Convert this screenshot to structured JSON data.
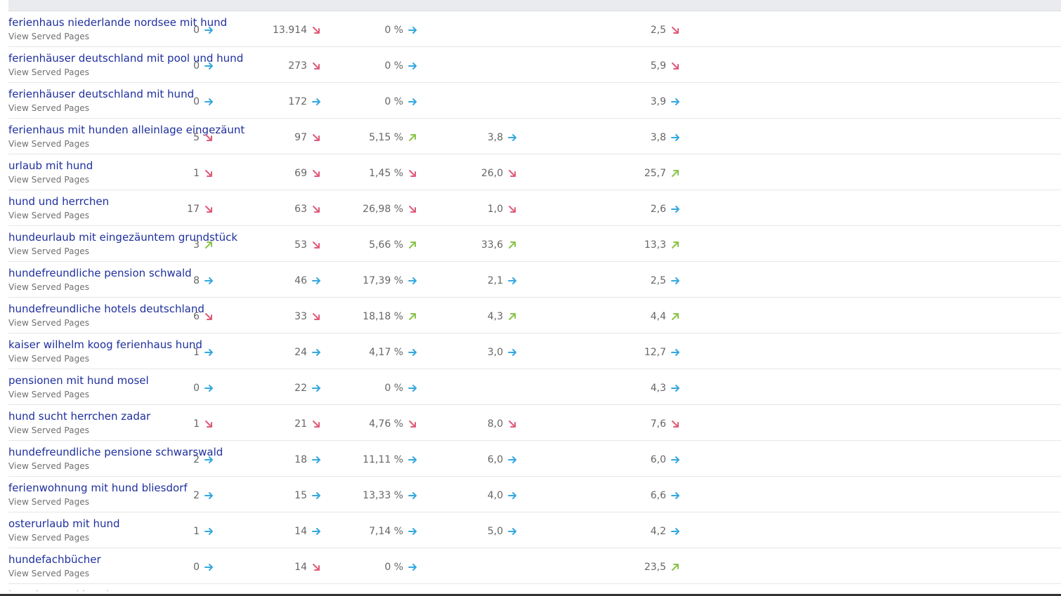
{
  "colors": {
    "link": "#1e2f9e",
    "trend_right": "#35a8e0",
    "trend_down": "#e05a78",
    "trend_up": "#8bc34a"
  },
  "rows": [
    {
      "keyword": "ferienhaus niederlande nordsee mit hund",
      "sub": "View Served Pages",
      "c1": {
        "v": "0",
        "t": "right"
      },
      "c2": {
        "v": "13.914",
        "t": "down"
      },
      "c3": {
        "v": "0 %",
        "t": "right"
      },
      "c4": {
        "v": "",
        "t": ""
      },
      "c5": {
        "v": "2,5",
        "t": "down"
      }
    },
    {
      "keyword": "ferienhäuser deutschland mit pool und hund",
      "sub": "View Served Pages",
      "c1": {
        "v": "0",
        "t": "right"
      },
      "c2": {
        "v": "273",
        "t": "down"
      },
      "c3": {
        "v": "0 %",
        "t": "right"
      },
      "c4": {
        "v": "",
        "t": ""
      },
      "c5": {
        "v": "5,9",
        "t": "down"
      }
    },
    {
      "keyword": "ferienhäuser deutschland mit hund",
      "sub": "View Served Pages",
      "c1": {
        "v": "0",
        "t": "right"
      },
      "c2": {
        "v": "172",
        "t": "right"
      },
      "c3": {
        "v": "0 %",
        "t": "right"
      },
      "c4": {
        "v": "",
        "t": ""
      },
      "c5": {
        "v": "3,9",
        "t": "right"
      }
    },
    {
      "keyword": "ferienhaus mit hunden alleinlage eingezäunt",
      "sub": "View Served Pages",
      "c1": {
        "v": "5",
        "t": "down"
      },
      "c2": {
        "v": "97",
        "t": "down"
      },
      "c3": {
        "v": "5,15 %",
        "t": "up"
      },
      "c4": {
        "v": "3,8",
        "t": "right"
      },
      "c5": {
        "v": "3,8",
        "t": "right"
      }
    },
    {
      "keyword": "urlaub mit hund",
      "sub": "View Served Pages",
      "c1": {
        "v": "1",
        "t": "down"
      },
      "c2": {
        "v": "69",
        "t": "down"
      },
      "c3": {
        "v": "1,45 %",
        "t": "down"
      },
      "c4": {
        "v": "26,0",
        "t": "down"
      },
      "c5": {
        "v": "25,7",
        "t": "up"
      }
    },
    {
      "keyword": "hund und herrchen",
      "sub": "View Served Pages",
      "c1": {
        "v": "17",
        "t": "down"
      },
      "c2": {
        "v": "63",
        "t": "down"
      },
      "c3": {
        "v": "26,98 %",
        "t": "down"
      },
      "c4": {
        "v": "1,0",
        "t": "down"
      },
      "c5": {
        "v": "2,6",
        "t": "right"
      }
    },
    {
      "keyword": "hundeurlaub mit eingezäuntem grundstück",
      "sub": "View Served Pages",
      "c1": {
        "v": "3",
        "t": "up"
      },
      "c2": {
        "v": "53",
        "t": "down"
      },
      "c3": {
        "v": "5,66 %",
        "t": "up"
      },
      "c4": {
        "v": "33,6",
        "t": "up"
      },
      "c5": {
        "v": "13,3",
        "t": "up"
      }
    },
    {
      "keyword": "hundefreundliche pension schwald",
      "sub": "View Served Pages",
      "c1": {
        "v": "8",
        "t": "right"
      },
      "c2": {
        "v": "46",
        "t": "right"
      },
      "c3": {
        "v": "17,39 %",
        "t": "right"
      },
      "c4": {
        "v": "2,1",
        "t": "right"
      },
      "c5": {
        "v": "2,5",
        "t": "right"
      }
    },
    {
      "keyword": "hundefreundliche hotels deutschland",
      "sub": "View Served Pages",
      "c1": {
        "v": "6",
        "t": "down"
      },
      "c2": {
        "v": "33",
        "t": "down"
      },
      "c3": {
        "v": "18,18 %",
        "t": "up"
      },
      "c4": {
        "v": "4,3",
        "t": "up"
      },
      "c5": {
        "v": "4,4",
        "t": "up"
      }
    },
    {
      "keyword": "kaiser wilhelm koog ferienhaus hund",
      "sub": "View Served Pages",
      "c1": {
        "v": "1",
        "t": "right"
      },
      "c2": {
        "v": "24",
        "t": "right"
      },
      "c3": {
        "v": "4,17 %",
        "t": "right"
      },
      "c4": {
        "v": "3,0",
        "t": "right"
      },
      "c5": {
        "v": "12,7",
        "t": "right"
      }
    },
    {
      "keyword": "pensionen mit hund mosel",
      "sub": "View Served Pages",
      "c1": {
        "v": "0",
        "t": "right"
      },
      "c2": {
        "v": "22",
        "t": "right"
      },
      "c3": {
        "v": "0 %",
        "t": "right"
      },
      "c4": {
        "v": "",
        "t": ""
      },
      "c5": {
        "v": "4,3",
        "t": "right"
      }
    },
    {
      "keyword": "hund sucht herrchen zadar",
      "sub": "View Served Pages",
      "c1": {
        "v": "1",
        "t": "down"
      },
      "c2": {
        "v": "21",
        "t": "down"
      },
      "c3": {
        "v": "4,76 %",
        "t": "down"
      },
      "c4": {
        "v": "8,0",
        "t": "down"
      },
      "c5": {
        "v": "7,6",
        "t": "down"
      }
    },
    {
      "keyword": "hundefreundliche pensione schwarswald",
      "sub": "View Served Pages",
      "c1": {
        "v": "2",
        "t": "right"
      },
      "c2": {
        "v": "18",
        "t": "right"
      },
      "c3": {
        "v": "11,11 %",
        "t": "right"
      },
      "c4": {
        "v": "6,0",
        "t": "right"
      },
      "c5": {
        "v": "6,0",
        "t": "right"
      }
    },
    {
      "keyword": "ferienwohnung mit hund bliesdorf",
      "sub": "View Served Pages",
      "c1": {
        "v": "2",
        "t": "right"
      },
      "c2": {
        "v": "15",
        "t": "right"
      },
      "c3": {
        "v": "13,33 %",
        "t": "right"
      },
      "c4": {
        "v": "4,0",
        "t": "right"
      },
      "c5": {
        "v": "6,6",
        "t": "right"
      }
    },
    {
      "keyword": "osterurlaub mit hund",
      "sub": "View Served Pages",
      "c1": {
        "v": "1",
        "t": "right"
      },
      "c2": {
        "v": "14",
        "t": "right"
      },
      "c3": {
        "v": "7,14 %",
        "t": "right"
      },
      "c4": {
        "v": "5,0",
        "t": "right"
      },
      "c5": {
        "v": "4,2",
        "t": "right"
      }
    },
    {
      "keyword": "hundefachbücher",
      "sub": "View Served Pages",
      "c1": {
        "v": "0",
        "t": "right"
      },
      "c2": {
        "v": "14",
        "t": "down"
      },
      "c3": {
        "v": "0 %",
        "t": "right"
      },
      "c4": {
        "v": "",
        "t": ""
      },
      "c5": {
        "v": "23,5",
        "t": "up"
      }
    }
  ],
  "cut_row": {
    "keyword": "herrchen und hund"
  }
}
